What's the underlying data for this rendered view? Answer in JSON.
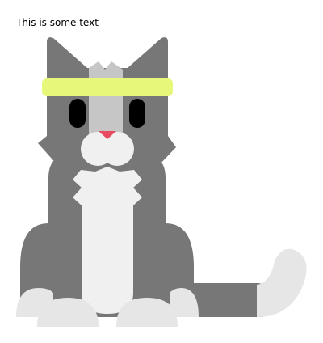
{
  "content": {
    "caption": "This is some text"
  },
  "illustration": {
    "icon": "cat-with-headband-icon",
    "colors": {
      "fur_dark": "#777777",
      "fur_light_stripe": "#c6c6c6",
      "chest_white": "#f0f0f0",
      "paws": "#e6e6e6",
      "tail_tip": "#e6e6e6",
      "headband": "#e6f77a",
      "nose": "#e84a5f",
      "eyes": "#000000"
    }
  }
}
